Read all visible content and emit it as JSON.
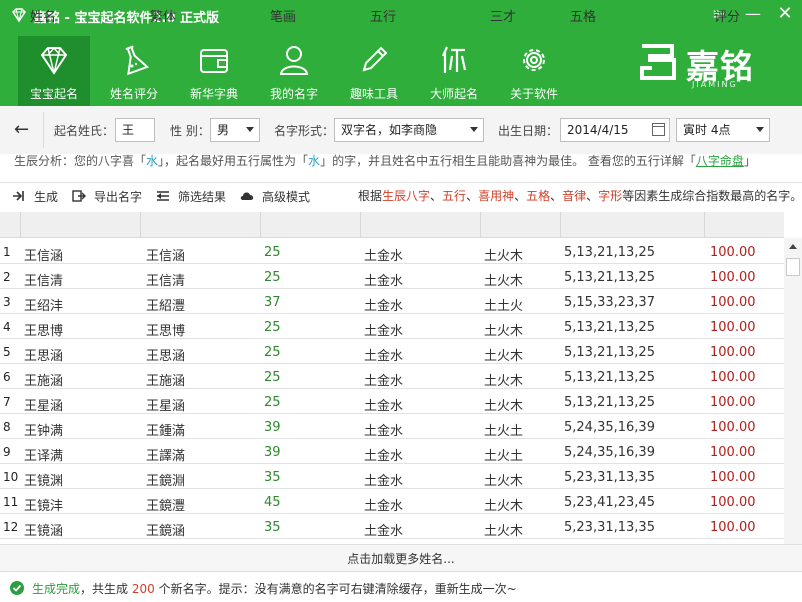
{
  "window": {
    "title": "嘉铭 - 宝宝起名软件2.0 正式版",
    "controls": {
      "menu": "≡",
      "minimize": "—",
      "close": "✕"
    }
  },
  "nav": {
    "items": [
      {
        "label": "宝宝起名",
        "icon": "diamond-icon",
        "active": true
      },
      {
        "label": "姓名评分",
        "icon": "lab-flask-icon",
        "active": false
      },
      {
        "label": "新华字典",
        "icon": "wallet-book-icon",
        "active": false
      },
      {
        "label": "我的名字",
        "icon": "person-icon",
        "active": false
      },
      {
        "label": "趣味工具",
        "icon": "pencil-icon",
        "active": false
      },
      {
        "label": "大师起名",
        "icon": "master-glyph-icon",
        "active": false
      },
      {
        "label": "关于软件",
        "icon": "gear-icon",
        "active": false
      }
    ]
  },
  "brand": {
    "name": "嘉铭",
    "sub": "JIAMING"
  },
  "form": {
    "back_icon": "arrow-left-icon",
    "surname_label": "起名姓氏：",
    "surname_value": "王",
    "gender_label": "性 别：",
    "gender_value": "男",
    "style_label": "名字形式：",
    "style_value": "双字名，如李商隐",
    "birth_label": "出生日期：",
    "birth_value": "2014/4/15",
    "hour_value": "寅时 4点"
  },
  "info": {
    "p1": "生辰分析：您的八字喜「",
    "w1": "水",
    "p2": "」，起名最好用五行属性为「",
    "w2": "水",
    "p3": "」的字，并且姓名中五行相生且能助喜神为最佳。 查看您的五行详解「",
    "link": "八字命盘",
    "p4": "」"
  },
  "actions": {
    "generate": "生成",
    "export": "导出名字",
    "filter": "筛选结果",
    "advanced": "高级模式"
  },
  "factors": {
    "p1": "根据",
    "f1": "生辰八字",
    "s1": "、",
    "f2": "五行",
    "s2": "、",
    "f3": "喜用神",
    "s3": "、",
    "f4": "五格",
    "s4": "、",
    "f5": "音律",
    "s5": "、",
    "f6": "字形",
    "p2": "等因素生成综合指数最高的名字。"
  },
  "table": {
    "headers": [
      "姓名",
      "繁体",
      "笔画",
      "五行",
      "三才",
      "五格",
      "评分"
    ],
    "rows": [
      [
        "1",
        "王信涵",
        "王信涵",
        "25",
        "土金水",
        "土火木",
        "5,13,21,13,25",
        "100.00"
      ],
      [
        "2",
        "王信清",
        "王信清",
        "25",
        "土金水",
        "土火木",
        "5,13,21,13,25",
        "100.00"
      ],
      [
        "3",
        "王绍沣",
        "王紹灃",
        "37",
        "土金水",
        "土土火",
        "5,15,33,23,37",
        "100.00"
      ],
      [
        "4",
        "王思博",
        "王思博",
        "25",
        "土金水",
        "土火木",
        "5,13,21,13,25",
        "100.00"
      ],
      [
        "5",
        "王思涵",
        "王思涵",
        "25",
        "土金水",
        "土火木",
        "5,13,21,13,25",
        "100.00"
      ],
      [
        "6",
        "王施涵",
        "王施涵",
        "25",
        "土金水",
        "土火木",
        "5,13,21,13,25",
        "100.00"
      ],
      [
        "7",
        "王星涵",
        "王星涵",
        "25",
        "土金水",
        "土火木",
        "5,13,21,13,25",
        "100.00"
      ],
      [
        "8",
        "王钟满",
        "王鍾滿",
        "39",
        "土金水",
        "土火土",
        "5,24,35,16,39",
        "100.00"
      ],
      [
        "9",
        "王译满",
        "王譯滿",
        "39",
        "土金水",
        "土火土",
        "5,24,35,16,39",
        "100.00"
      ],
      [
        "10",
        "王镜渊",
        "王鏡淵",
        "35",
        "土金水",
        "土火木",
        "5,23,31,13,35",
        "100.00"
      ],
      [
        "11",
        "王镜沣",
        "王鏡灃",
        "45",
        "土金水",
        "土火木",
        "5,23,41,23,45",
        "100.00"
      ],
      [
        "12",
        "王镜涵",
        "王鏡涵",
        "35",
        "土金水",
        "土火木",
        "5,23,31,13,35",
        "100.00"
      ]
    ]
  },
  "load_more": "点击加载更多姓名...",
  "status": {
    "done": "生成完成",
    "p1": "，共生成 ",
    "count": "200",
    "p2": " 个新名字。提示：没有满意的名字可右键清除缓存，重新生成一次~"
  },
  "colors": {
    "brand_green": "#2fae3b",
    "active_nav": "#1f8e2c",
    "score_red": "#b0201c",
    "stroke_green": "#2c8a2c"
  }
}
